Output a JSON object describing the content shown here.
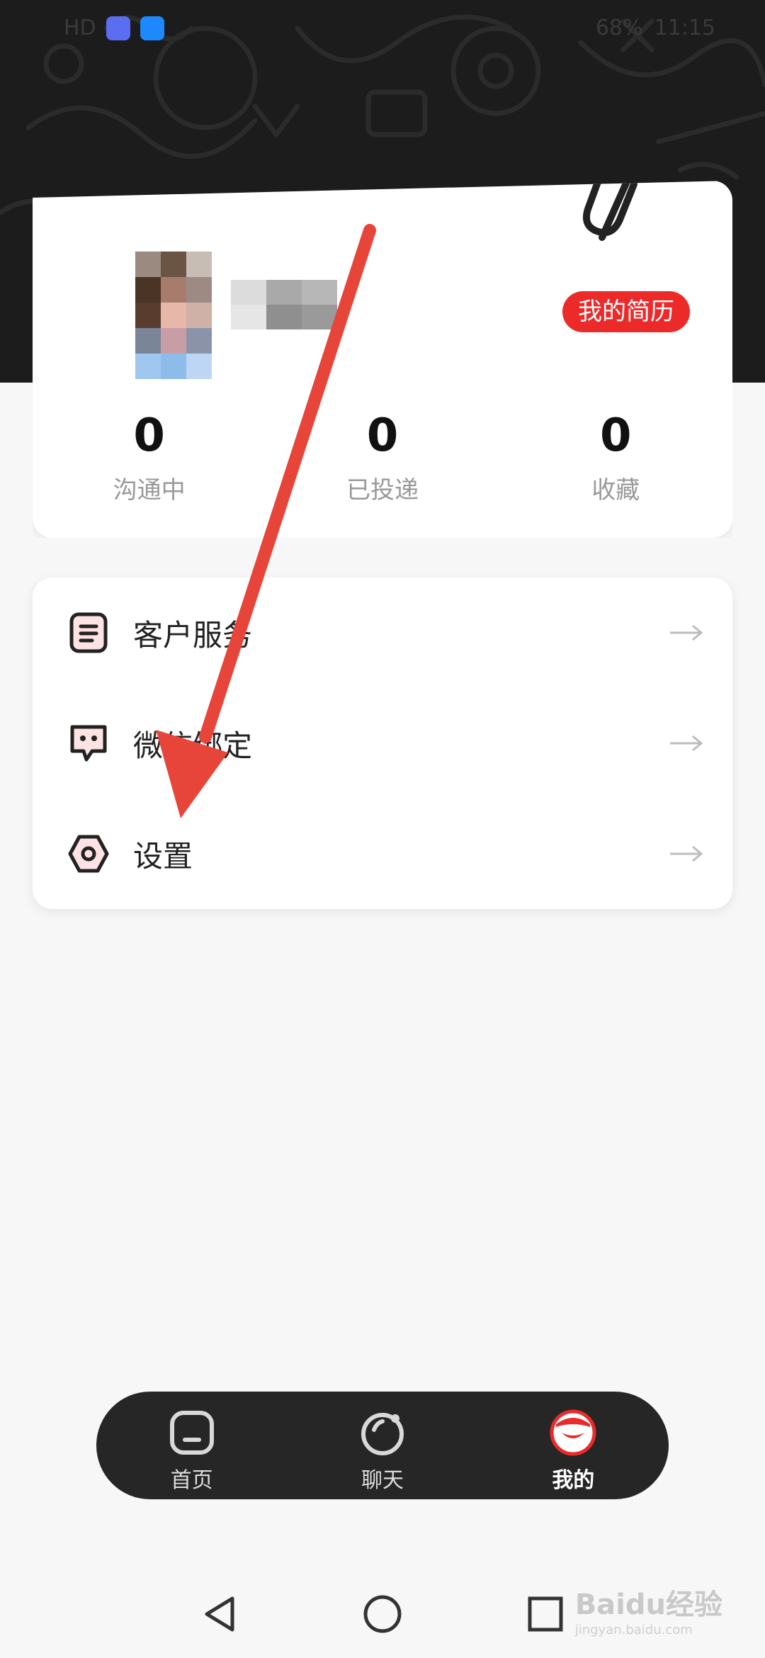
{
  "status_bar": {
    "left_label": "HD",
    "battery": "68%",
    "time": "11:15"
  },
  "profile": {
    "resume_button": "我的简历",
    "stats": [
      {
        "value": "0",
        "label": "沟通中"
      },
      {
        "value": "0",
        "label": "已投递"
      },
      {
        "value": "0",
        "label": "收藏"
      }
    ]
  },
  "menu": {
    "items": [
      {
        "label": "客户服务",
        "icon": "document-icon"
      },
      {
        "label": "微信绑定",
        "icon": "chat-bubble-icon"
      },
      {
        "label": "设置",
        "icon": "hexagon-settings-icon"
      }
    ]
  },
  "tabbar": {
    "tabs": [
      {
        "label": "首页",
        "icon": "home-icon",
        "active": false
      },
      {
        "label": "聊天",
        "icon": "chat-icon",
        "active": false
      },
      {
        "label": "我的",
        "icon": "profile-icon",
        "active": true
      }
    ]
  },
  "watermark": {
    "brand": "Baidu经验",
    "url": "jingyan.baidu.com"
  },
  "colors": {
    "accent": "#ec2a2a",
    "header_bg": "#1c1c1c",
    "tabbar_bg": "#262626",
    "annotation": "#e8453a"
  }
}
